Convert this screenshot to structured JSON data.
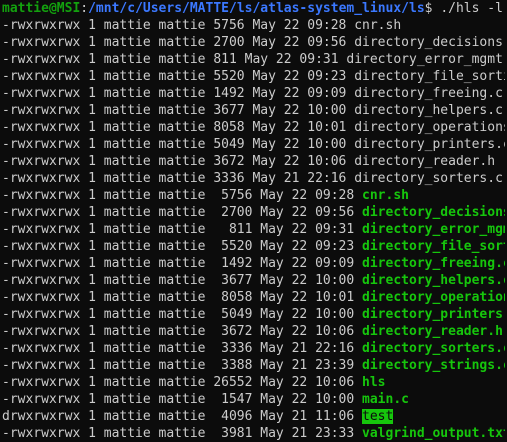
{
  "prompt": {
    "user": "mattie@MSI",
    "separator": ":",
    "path": "/mnt/c/Users/MATTE/ls/atlas-system_linux/ls",
    "symbol": "$ ",
    "command": "./hls -l"
  },
  "colors": {
    "background": "#0c0c0c",
    "text": "#cccccc",
    "prompt_user": "#13a10e",
    "prompt_path": "#3b78ff",
    "exec_name": "#16c60c"
  },
  "output_lines": [
    {
      "meta": "-rwxrwxrwx 1 mattie mattie 5756 May 22 09:28 ",
      "name": "cnr.sh",
      "style": "plain"
    },
    {
      "meta": "-rwxrwxrwx 1 mattie mattie 2700 May 22 09:56 ",
      "name": "directory_decisions.c",
      "style": "plain"
    },
    {
      "meta": "-rwxrwxrwx 1 mattie mattie 811 May 22 09:31 ",
      "name": "directory_error_mgmt.c",
      "style": "plain"
    },
    {
      "meta": "-rwxrwxrwx 1 mattie mattie 5520 May 22 09:23 ",
      "name": "directory_file_sorting.c",
      "style": "plain"
    },
    {
      "meta": "-rwxrwxrwx 1 mattie mattie 1492 May 22 09:09 ",
      "name": "directory_freeing.c",
      "style": "plain"
    },
    {
      "meta": "-rwxrwxrwx 1 mattie mattie 3677 May 22 10:00 ",
      "name": "directory_helpers.c",
      "style": "plain"
    },
    {
      "meta": "-rwxrwxrwx 1 mattie mattie 8058 May 22 10:01 ",
      "name": "directory_operations.c",
      "style": "plain"
    },
    {
      "meta": "-rwxrwxrwx 1 mattie mattie 5049 May 22 10:00 ",
      "name": "directory_printers.c",
      "style": "plain"
    },
    {
      "meta": "-rwxrwxrwx 1 mattie mattie 3672 May 22 10:06 ",
      "name": "directory_reader.h",
      "style": "plain"
    },
    {
      "meta": "-rwxrwxrwx 1 mattie mattie 3336 May 21 22:16 ",
      "name": "directory_sorters.c",
      "style": "plain"
    },
    {
      "meta": "-rwxrwxrwx 1 mattie mattie  5756 May 22 09:28 ",
      "name": "cnr.sh",
      "style": "exec"
    },
    {
      "meta": "-rwxrwxrwx 1 mattie mattie  2700 May 22 09:56 ",
      "name": "directory_decisions.c",
      "style": "exec"
    },
    {
      "meta": "-rwxrwxrwx 1 mattie mattie   811 May 22 09:31 ",
      "name": "directory_error_mgmt.c",
      "style": "exec"
    },
    {
      "meta": "-rwxrwxrwx 1 mattie mattie  5520 May 22 09:23 ",
      "name": "directory_file_sorting.c",
      "style": "exec"
    },
    {
      "meta": "-rwxrwxrwx 1 mattie mattie  1492 May 22 09:09 ",
      "name": "directory_freeing.c",
      "style": "exec"
    },
    {
      "meta": "-rwxrwxrwx 1 mattie mattie  3677 May 22 10:00 ",
      "name": "directory_helpers.c",
      "style": "exec"
    },
    {
      "meta": "-rwxrwxrwx 1 mattie mattie  8058 May 22 10:01 ",
      "name": "directory_operations.c",
      "style": "exec"
    },
    {
      "meta": "-rwxrwxrwx 1 mattie mattie  5049 May 22 10:00 ",
      "name": "directory_printers.c",
      "style": "exec"
    },
    {
      "meta": "-rwxrwxrwx 1 mattie mattie  3672 May 22 10:06 ",
      "name": "directory_reader.h",
      "style": "exec"
    },
    {
      "meta": "-rwxrwxrwx 1 mattie mattie  3336 May 21 22:16 ",
      "name": "directory_sorters.c",
      "style": "exec"
    },
    {
      "meta": "-rwxrwxrwx 1 mattie mattie  3388 May 21 23:39 ",
      "name": "directory_strings.c",
      "style": "exec"
    },
    {
      "meta": "-rwxrwxrwx 1 mattie mattie 26552 May 22 10:06 ",
      "name": "hls",
      "style": "exec"
    },
    {
      "meta": "-rwxrwxrwx 1 mattie mattie  1547 May 22 10:00 ",
      "name": "main.c",
      "style": "exec"
    },
    {
      "meta": "drwxrwxrwx 1 mattie mattie  4096 May 21 11:06 ",
      "name": "test",
      "style": "dir-hl"
    },
    {
      "meta": "-rwxrwxrwx 1 mattie mattie  3981 May 21 23:33 ",
      "name": "valgrind_output.txt",
      "style": "exec"
    }
  ]
}
